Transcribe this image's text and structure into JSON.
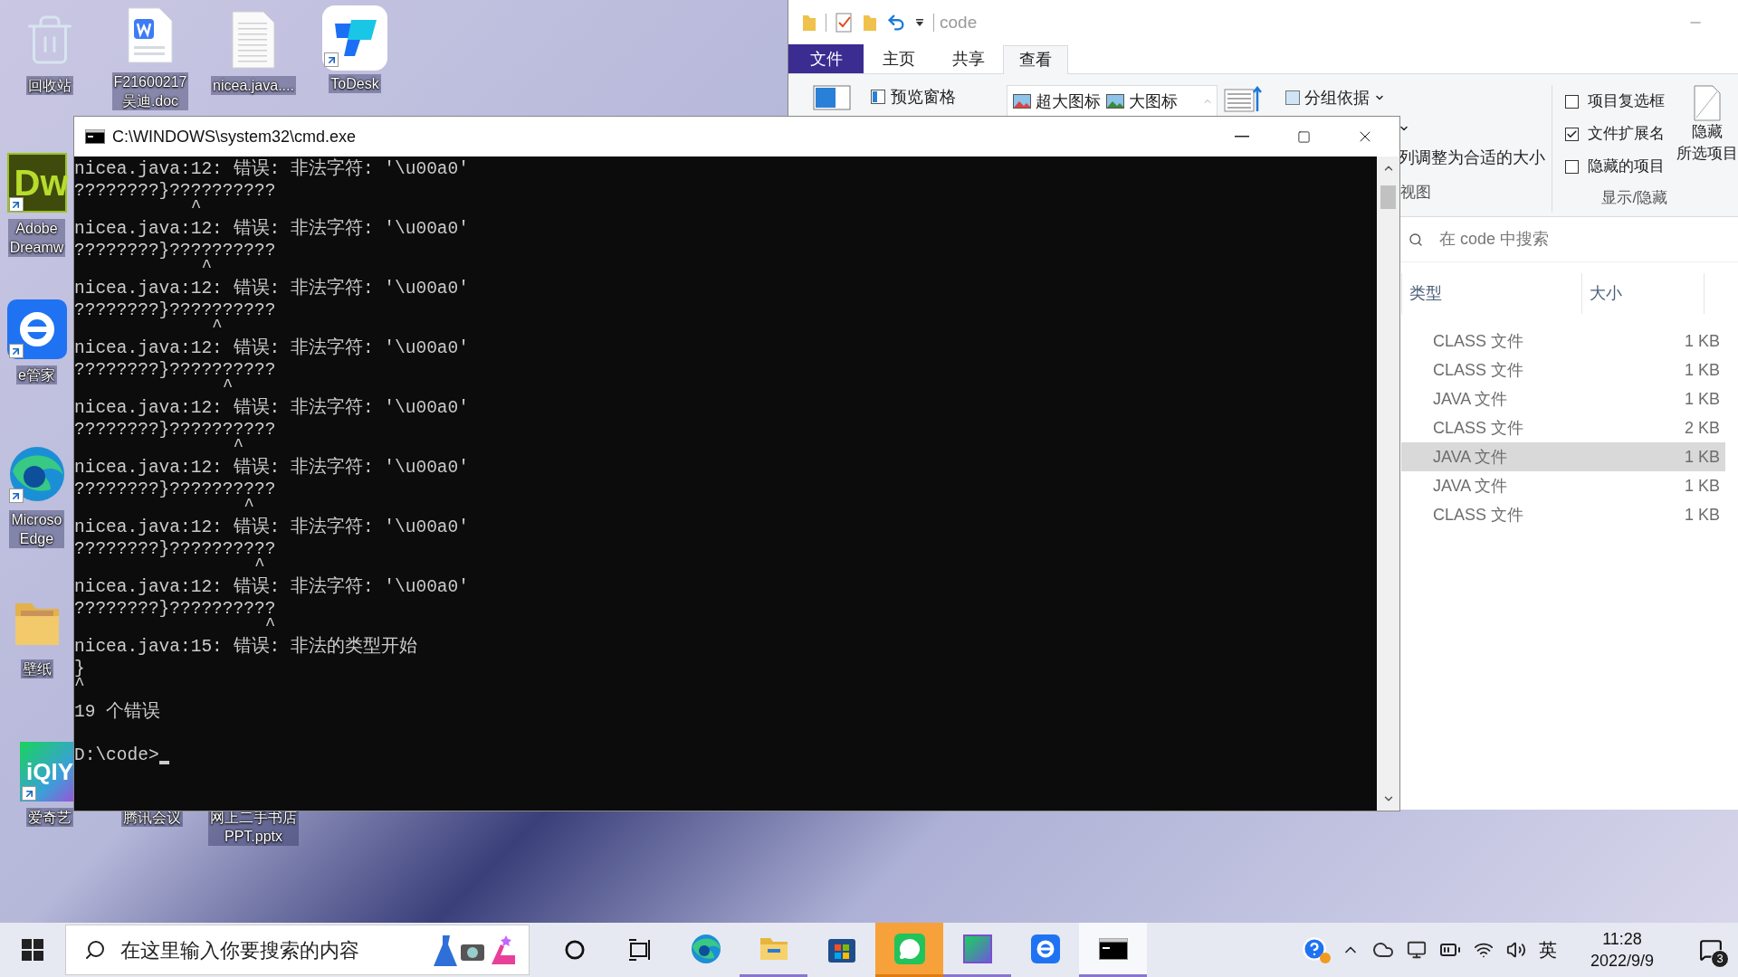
{
  "desktop_icons": [
    {
      "label": [
        "回收站"
      ],
      "kind": "recycle-bin",
      "shortcut": false
    },
    {
      "label": [
        "F21600217",
        "吴迪.doc"
      ],
      "kind": "word-doc",
      "shortcut": false
    },
    {
      "label": [
        "nicea.java...."
      ],
      "kind": "text-file",
      "shortcut": false
    },
    {
      "label": [
        "ToDesk"
      ],
      "kind": "todesk",
      "shortcut": true
    },
    {
      "label": [
        "Adobe",
        "Dreamw"
      ],
      "kind": "dreamweaver",
      "logo_text": "Dw",
      "shortcut": true
    },
    {
      "label": [
        "e管家"
      ],
      "kind": "emanager",
      "shortcut": true
    },
    {
      "label": [
        "Microso",
        "Edge"
      ],
      "kind": "edge",
      "shortcut": true
    },
    {
      "label": [
        "壁纸"
      ],
      "kind": "folder",
      "shortcut": false
    },
    {
      "label": [
        "爱奇艺"
      ],
      "kind": "iqiyi",
      "logo_text": "iQIY",
      "shortcut": true
    },
    {
      "label": [
        "腾讯会议"
      ]
    },
    {
      "label": [
        "网上二手书店",
        "PPT.pptx"
      ]
    }
  ],
  "explorer": {
    "title": "code",
    "tabs": [
      {
        "label": "文件",
        "kind": "menu",
        "selected": false
      },
      {
        "label": "主页",
        "kind": "tab",
        "selected": false
      },
      {
        "label": "共享",
        "kind": "tab",
        "selected": false
      },
      {
        "label": "查看",
        "kind": "tab",
        "selected": true
      }
    ],
    "ribbon": {
      "preview_pane": "预览窗格",
      "layouts": [
        "超大图标",
        "大图标"
      ],
      "group_by": "分组依据",
      "size_columns": "列调整为合适的大小",
      "view_group": "视图",
      "checkboxes": [
        {
          "label": "项目复选框",
          "checked": false
        },
        {
          "label": "文件扩展名",
          "checked": true
        },
        {
          "label": "隐藏的项目",
          "checked": false
        }
      ],
      "hide_button": [
        "隐藏",
        "所选项目"
      ],
      "show_hide_group": "显示/隐藏"
    },
    "search": {
      "placeholder": "在 code 中搜索"
    },
    "columns": [
      "类型",
      "大小"
    ],
    "rows": [
      {
        "type": "CLASS 文件",
        "size": "1 KB",
        "selected": false
      },
      {
        "type": "CLASS 文件",
        "size": "1 KB",
        "selected": false
      },
      {
        "type": "JAVA 文件",
        "size": "1 KB",
        "selected": false
      },
      {
        "type": "CLASS 文件",
        "size": "2 KB",
        "selected": false
      },
      {
        "type": "JAVA 文件",
        "size": "1 KB",
        "selected": true
      },
      {
        "type": "JAVA 文件",
        "size": "1 KB",
        "selected": false
      },
      {
        "type": "CLASS 文件",
        "size": "1 KB",
        "selected": false
      }
    ]
  },
  "cmd": {
    "title": "C:\\WINDOWS\\system32\\cmd.exe",
    "errors": [
      {
        "message": "nicea.java:12: 错误: 非法字符: '\\u00a0'",
        "source": "????????}??????????",
        "caret": "           ^"
      },
      {
        "message": "nicea.java:12: 错误: 非法字符: '\\u00a0'",
        "source": "????????}??????????",
        "caret": "            ^"
      },
      {
        "message": "nicea.java:12: 错误: 非法字符: '\\u00a0'",
        "source": "????????}??????????",
        "caret": "             ^"
      },
      {
        "message": "nicea.java:12: 错误: 非法字符: '\\u00a0'",
        "source": "????????}??????????",
        "caret": "              ^"
      },
      {
        "message": "nicea.java:12: 错误: 非法字符: '\\u00a0'",
        "source": "????????}??????????",
        "caret": "               ^"
      },
      {
        "message": "nicea.java:12: 错误: 非法字符: '\\u00a0'",
        "source": "????????}??????????",
        "caret": "                ^"
      },
      {
        "message": "nicea.java:12: 错误: 非法字符: '\\u00a0'",
        "source": "????????}??????????",
        "caret": "                 ^"
      },
      {
        "message": "nicea.java:12: 错误: 非法字符: '\\u00a0'",
        "source": "????????}??????????",
        "caret": "                  ^"
      },
      {
        "message": "nicea.java:15: 错误: 非法的类型开始",
        "source": "}",
        "caret": "^"
      }
    ],
    "summary": "19 个错误",
    "prompt": "D:\\code>"
  },
  "taskbar": {
    "search": {
      "placeholder": "在这里输入你要搜索的内容"
    },
    "apps": [
      {
        "kind": "edge",
        "open": false,
        "focused": false,
        "flashing": false
      },
      {
        "kind": "folder",
        "open": true,
        "focused": false,
        "flashing": false
      },
      {
        "kind": "store",
        "open": false,
        "focused": false,
        "flashing": false
      },
      {
        "kind": "wechat",
        "open": true,
        "focused": false,
        "flashing": true
      },
      {
        "kind": "iqiyi",
        "open": true,
        "focused": false,
        "flashing": false
      },
      {
        "kind": "emanager",
        "open": false,
        "focused": false,
        "flashing": false
      },
      {
        "kind": "terminal",
        "open": true,
        "focused": true,
        "flashing": false
      }
    ],
    "tray": {
      "input_method": "英",
      "time": "11:28",
      "date": "2022/9/9",
      "notifications": "3"
    }
  }
}
